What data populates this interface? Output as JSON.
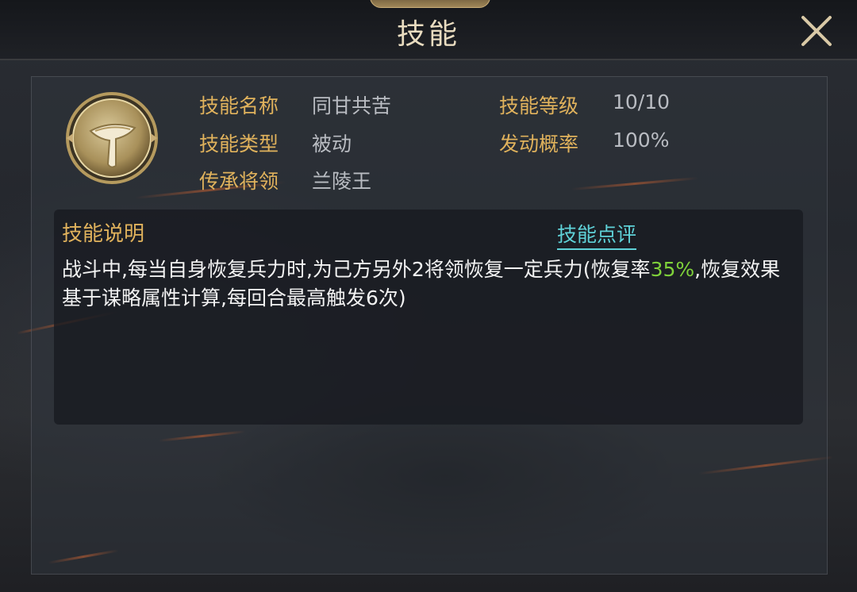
{
  "header": {
    "title": "技能"
  },
  "skill": {
    "icon": "scroll-feather-icon",
    "fields": {
      "name_label": "技能名称",
      "name_value": "同甘共苦",
      "level_label": "技能等级",
      "level_value": "10/10",
      "type_label": "技能类型",
      "type_value": "被动",
      "chance_label": "发动概率",
      "chance_value": "100%",
      "inherit_label": "传承将领",
      "inherit_value": "兰陵王"
    }
  },
  "description": {
    "title": "技能说明",
    "review_link": "技能点评",
    "text_part1": "战斗中,每当自身恢复兵力时,为己方另外2将领恢复一定兵力(恢复率",
    "highlight": "35%",
    "text_part2": ",恢复效果基于谋略属性计算,每回合最高触发6次)"
  },
  "colors": {
    "label_gold": "#e0b25c",
    "value_gray": "#b9bcc2",
    "link_cyan": "#5fd2d8",
    "highlight_green": "#7fd23a"
  }
}
